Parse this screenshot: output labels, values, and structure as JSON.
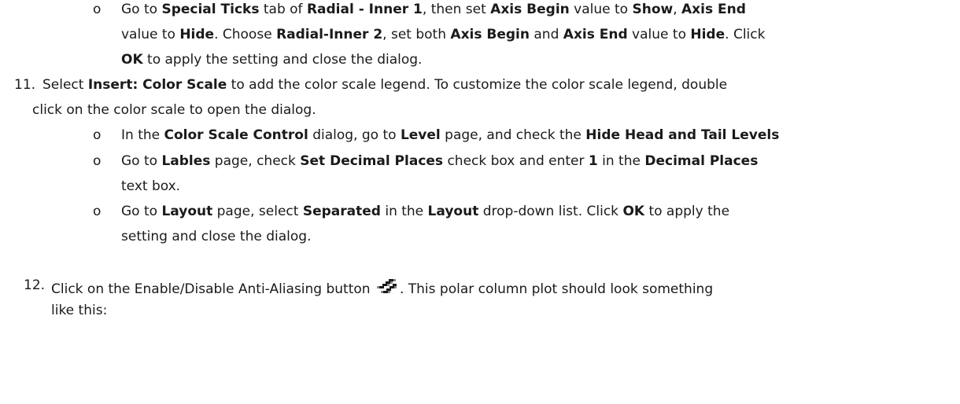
{
  "steps": {
    "sub_step_10c": {
      "bullet": "o",
      "line1": {
        "t1": "Go to ",
        "b1": "Special Ticks",
        "t2": " tab of ",
        "b2": "Radial - Inner 1",
        "t3": ", then set ",
        "b3": "Axis Begin",
        "t4": " value to ",
        "b4": "Show",
        "t5": ", ",
        "b5": "Axis End"
      },
      "line2": {
        "t1": "value to ",
        "b1": "Hide",
        "t2": ". Choose ",
        "b2": "Radial-Inner 2",
        "t3": ", set both ",
        "b3": "Axis Begin",
        "t4": " and ",
        "b4": "Axis End",
        "t5": " value to ",
        "b5": "Hide",
        "t6": ". Click"
      },
      "line3": {
        "b1": "OK",
        "t1": " to apply the setting and close the dialog."
      }
    },
    "step_11": {
      "number": "11.",
      "line1": {
        "t1": "Select ",
        "b1": "Insert: Color Scale",
        "t2": " to add the color scale legend. To customize the color scale legend, double"
      },
      "line2": {
        "t1": "click on the color scale to open the dialog."
      },
      "sub_a": {
        "bullet": "o",
        "t1": "In the ",
        "b1": "Color Scale Control",
        "t2": " dialog, go to ",
        "b2": "Level",
        "t3": " page, and check the ",
        "b3": "Hide Head and Tail Levels"
      },
      "sub_b": {
        "bullet": "o",
        "line1": {
          "t1": "Go to ",
          "b1": "Lables",
          "t2": " page, check ",
          "b2": "Set Decimal Places",
          "t3": " check box and enter ",
          "b3": "1",
          "t4": " in the ",
          "b4": "Decimal Places"
        },
        "line2": {
          "t1": "text box."
        }
      },
      "sub_c": {
        "bullet": "o",
        "line1": {
          "t1": "Go to ",
          "b1": "Layout",
          "t2": " page, select ",
          "b2": "Separated",
          "t3": " in the ",
          "b3": "Layout",
          "t4": " drop-down list. Click ",
          "b4": "OK",
          "t5": " to apply the"
        },
        "line2": {
          "t1": "setting and close the dialog."
        }
      }
    },
    "step_12": {
      "number": "12.",
      "line1": {
        "t1": "Click on the Enable/Disable Anti-Aliasing button",
        "icon": "anti-aliasing-icon",
        "t2": ". This polar column plot should look something"
      },
      "line2": {
        "t1": "like this:"
      }
    }
  }
}
